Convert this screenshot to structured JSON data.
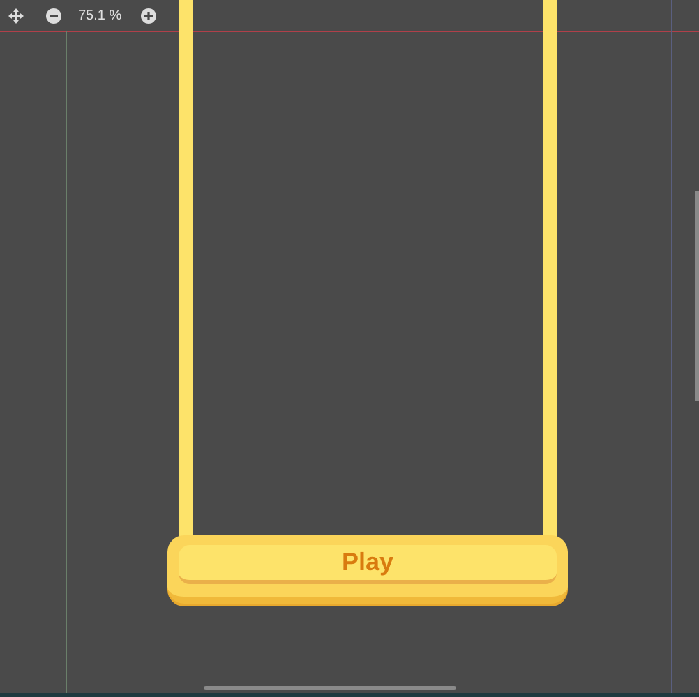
{
  "toolbar": {
    "zoom": "75.1 %"
  },
  "play_button": {
    "label": "Play"
  }
}
